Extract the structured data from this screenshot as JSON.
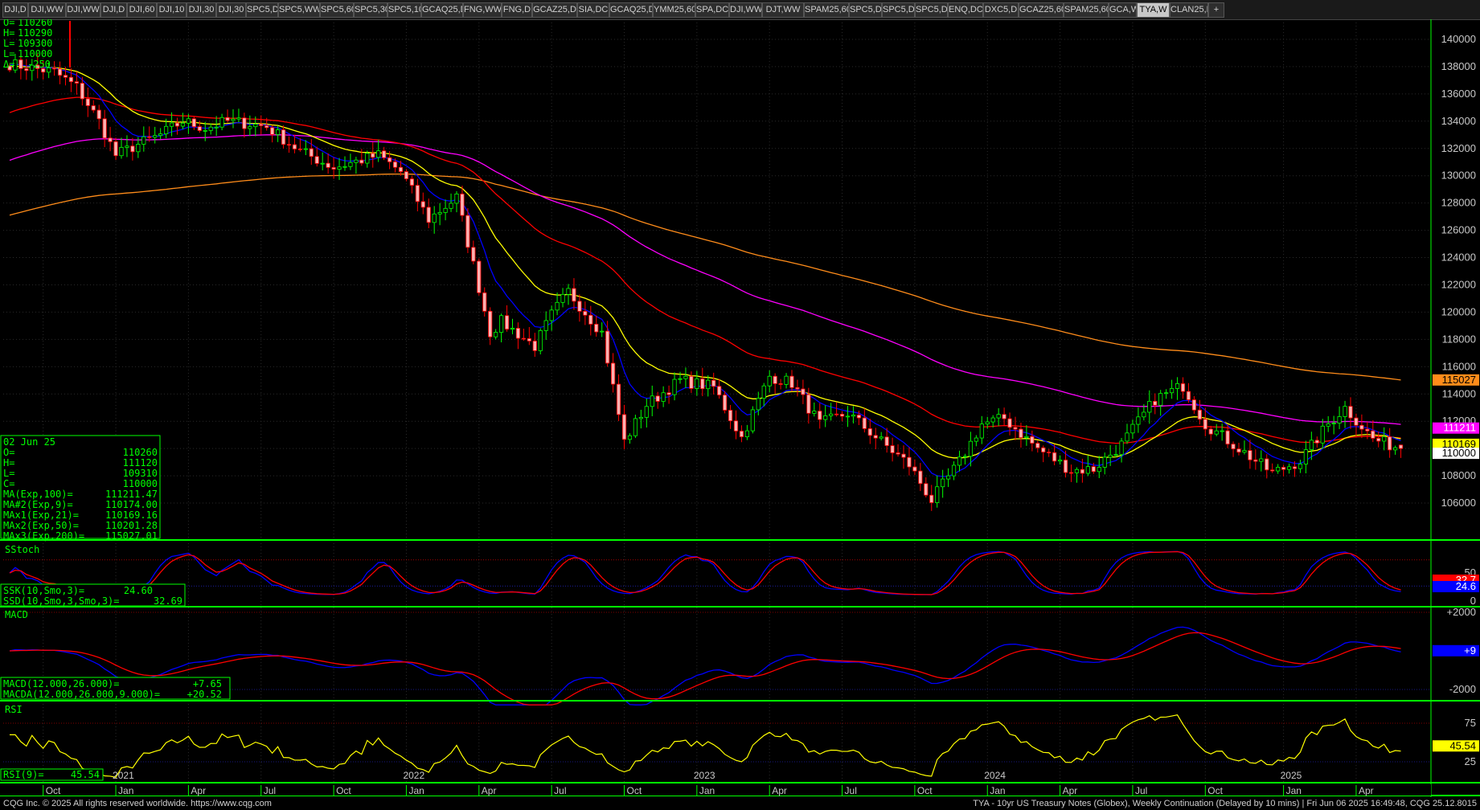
{
  "tabs": [
    "DJI,D",
    "DJI,WW",
    "DJI,WW",
    "DJI,D",
    "DJI,60",
    "DJI,10",
    "DJI,30",
    "DJI,30",
    "SPC5,D",
    "SPC5,WW",
    "SPC5,60",
    "SPC5,30",
    "SPC5,10",
    "GCAQ25,D",
    "FNG,WW",
    "FNG,D",
    "GCAZ25,D",
    "SIA,DC",
    "GCAQ25,D",
    "YMM25,60",
    "SPA,DC",
    "DJI,WW",
    "DJT,WW",
    "SPAM25,60",
    "SPC5,D",
    "SPC5,D",
    "SPC5,D",
    "ENQ,DC",
    "DXC5,D",
    "GCAZ25,60",
    "SPAM25,60",
    "GCA,W",
    "TYA,W",
    "CLAN25,D",
    "+"
  ],
  "active_tab": 32,
  "ohlc_header": [
    {
      "label": "O=",
      "value": "110260"
    },
    {
      "label": "H=",
      "value": "110290"
    },
    {
      "label": "L=",
      "value": "109300"
    },
    {
      "label": "L=",
      "value": "110000"
    },
    {
      "label": "Δ=",
      "value": "-250"
    }
  ],
  "info_box": {
    "date": "02 Jun 25",
    "rows": [
      {
        "label": "O=",
        "value": "110260"
      },
      {
        "label": "H=",
        "value": "111120"
      },
      {
        "label": "L=",
        "value": "109310"
      },
      {
        "label": "C=",
        "value": "110000"
      },
      {
        "label": "MA(Exp,100)=",
        "value": "111211.47"
      },
      {
        "label": "MA#2(Exp,9)=",
        "value": "110174.00"
      },
      {
        "label": "MAx1(Exp,21)=",
        "value": "110169.16"
      },
      {
        "label": "MAx2(Exp,50)=",
        "value": "110201.28"
      },
      {
        "label": "MAx3(Exp,200)=",
        "value": "115027.01"
      }
    ]
  },
  "price_axis": {
    "min": 104000,
    "max": 141000,
    "ticks": [
      "140000",
      "138000",
      "136000",
      "134000",
      "132000",
      "130000",
      "128000",
      "126000",
      "124000",
      "122000",
      "120000",
      "118000",
      "116000",
      "114000",
      "112000",
      "110000",
      "108000",
      "106000"
    ]
  },
  "price_flags": [
    {
      "value": "115027",
      "price": 115027,
      "color": "#ff8c1a",
      "text": "#000000"
    },
    {
      "value": "111211",
      "price": 111500,
      "color": "#ff00ff",
      "text": "#ffffff"
    },
    {
      "value": "110169",
      "price": 110310,
      "color": "#ffff00",
      "text": "#000000"
    },
    {
      "value": "110000",
      "price": 109650,
      "color": "#ffffff",
      "text": "#000000"
    }
  ],
  "sstoch": {
    "title": "SStoch",
    "ssk_label": "SSK(10,Smo,3)=",
    "ssk_value": "24.60",
    "ssd_label": "SSD(10,Smo,3,Smo,3)=",
    "ssd_value": "32.69",
    "axis": [
      "50",
      "0"
    ],
    "flags": [
      {
        "value": "24.6",
        "color": "#0000ff"
      },
      {
        "value": "32.7",
        "color": "#ff0000"
      }
    ]
  },
  "macd": {
    "title": "MACD",
    "macd_label": "MACD(12.000,26.000)=",
    "macd_value": "+7.65",
    "macda_label": "MACDA(12.000,26.000,9.000)=",
    "macda_value": "+20.52",
    "axis": [
      "+2000",
      "-2000"
    ],
    "flag": "+9"
  },
  "rsi": {
    "title": "RSI",
    "label": "RSI(9)=",
    "value": "45.54",
    "axis": [
      "75",
      "25"
    ],
    "flag": "45.54"
  },
  "date_axis": {
    "years": [
      {
        "label": "2021",
        "i": 19
      },
      {
        "label": "2022",
        "i": 71
      },
      {
        "label": "2023",
        "i": 123
      },
      {
        "label": "2024",
        "i": 175
      },
      {
        "label": "2025",
        "i": 228
      }
    ],
    "months": [
      {
        "label": "Oct",
        "i": 6
      },
      {
        "label": "Jan",
        "i": 19
      },
      {
        "label": "Apr",
        "i": 32
      },
      {
        "label": "Jul",
        "i": 45
      },
      {
        "label": "Oct",
        "i": 58
      },
      {
        "label": "Jan",
        "i": 71
      },
      {
        "label": "Apr",
        "i": 84
      },
      {
        "label": "Jul",
        "i": 97
      },
      {
        "label": "Oct",
        "i": 110
      },
      {
        "label": "Jan",
        "i": 123
      },
      {
        "label": "Apr",
        "i": 136
      },
      {
        "label": "Jul",
        "i": 149
      },
      {
        "label": "Oct",
        "i": 162
      },
      {
        "label": "Jan",
        "i": 175
      },
      {
        "label": "Apr",
        "i": 188
      },
      {
        "label": "Jul",
        "i": 201
      },
      {
        "label": "Oct",
        "i": 214
      },
      {
        "label": "Jan",
        "i": 228
      },
      {
        "label": "Apr",
        "i": 241
      }
    ]
  },
  "chart_data": {
    "type": "candlestick",
    "bar_count": 250,
    "price_keypoints": [
      [
        0,
        138200
      ],
      [
        8,
        137600
      ],
      [
        12,
        136500
      ],
      [
        16,
        134000
      ],
      [
        19,
        131500
      ],
      [
        23,
        132300
      ],
      [
        27,
        133000
      ],
      [
        31,
        134000
      ],
      [
        35,
        133500
      ],
      [
        39,
        134000
      ],
      [
        43,
        133800
      ],
      [
        46,
        133600
      ],
      [
        52,
        131800
      ],
      [
        58,
        130600
      ],
      [
        66,
        131500
      ],
      [
        70,
        130300
      ],
      [
        75,
        126800
      ],
      [
        80,
        128400
      ],
      [
        86,
        118500
      ],
      [
        88,
        119300
      ],
      [
        94,
        117500
      ],
      [
        97,
        119800
      ],
      [
        100,
        121500
      ],
      [
        106,
        118500
      ],
      [
        110,
        110500
      ],
      [
        114,
        113200
      ],
      [
        120,
        115000
      ],
      [
        126,
        114500
      ],
      [
        131,
        110800
      ],
      [
        136,
        115300
      ],
      [
        140,
        114800
      ],
      [
        145,
        111800
      ],
      [
        150,
        112600
      ],
      [
        156,
        110500
      ],
      [
        161,
        108800
      ],
      [
        165,
        106200
      ],
      [
        170,
        109000
      ],
      [
        174,
        111800
      ],
      [
        178,
        112200
      ],
      [
        184,
        110000
      ],
      [
        190,
        108400
      ],
      [
        194,
        108500
      ],
      [
        199,
        110300
      ],
      [
        205,
        113600
      ],
      [
        210,
        114600
      ],
      [
        214,
        111800
      ],
      [
        220,
        110000
      ],
      [
        226,
        108200
      ],
      [
        231,
        109100
      ],
      [
        236,
        111800
      ],
      [
        239,
        113000
      ],
      [
        244,
        110700
      ],
      [
        249,
        110000
      ]
    ],
    "moving_averages": [
      {
        "name": "MA(Exp,100)",
        "color": "#ff00ff",
        "last": 111211.47
      },
      {
        "name": "MA#2(Exp,9)",
        "color": "#0000ff",
        "last": 110174.0
      },
      {
        "name": "MAx1(Exp,21)",
        "color": "#ffff00",
        "last": 110169.16
      },
      {
        "name": "MAx2(Exp,50)",
        "color": "#ff0000",
        "last": 110201.28
      },
      {
        "name": "MAx3(Exp,200)",
        "color": "#ff8c1a",
        "last": 115027.01
      }
    ]
  },
  "footer": {
    "left": "CQG Inc. © 2025 All rights reserved worldwide. https://www.cqg.com",
    "right": "TYA - 10yr US Treasury Notes (Globex), Weekly Continuation (Delayed by 10 mins) | Fri Jun 06 2025 16:49:48, CQG 25.12.8015"
  },
  "colors": {
    "up": "#00ff00",
    "down": "#ff0000",
    "panel_border": "#00ff00",
    "grid": "#303030",
    "axis_text": "#c8c8c8"
  }
}
